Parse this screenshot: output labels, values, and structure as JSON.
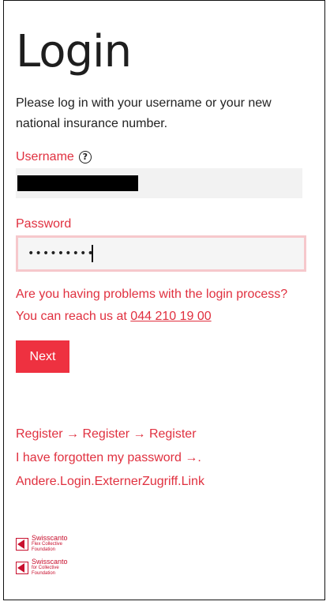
{
  "page": {
    "title": "Login",
    "intro": "Please log in with your username or your new national insurance number."
  },
  "form": {
    "username_label": "Username",
    "help_icon": "question-circle-icon",
    "username_value": "",
    "password_label": "Password",
    "password_value": "•••••••••",
    "problem_text": "Are you having problems with the login process? You can reach us at ",
    "phone": "044 210 19 00",
    "next_label": "Next"
  },
  "links": [
    "Register → Register → Register",
    "I have forgotten my password →.",
    "Andere.Login.ExternerZugriff.Link"
  ],
  "logos": [
    {
      "name": "Swisscanto",
      "sub1": "Flex Collective",
      "sub2": "Foundation"
    },
    {
      "name": "Swisscanto",
      "sub1": "for Collective",
      "sub2": "Foundation"
    }
  ],
  "colors": {
    "accent": "#ee3140",
    "label_red": "#e0303f",
    "input_bg": "#f2f2f2",
    "focus_border": "#f6c8cc"
  }
}
